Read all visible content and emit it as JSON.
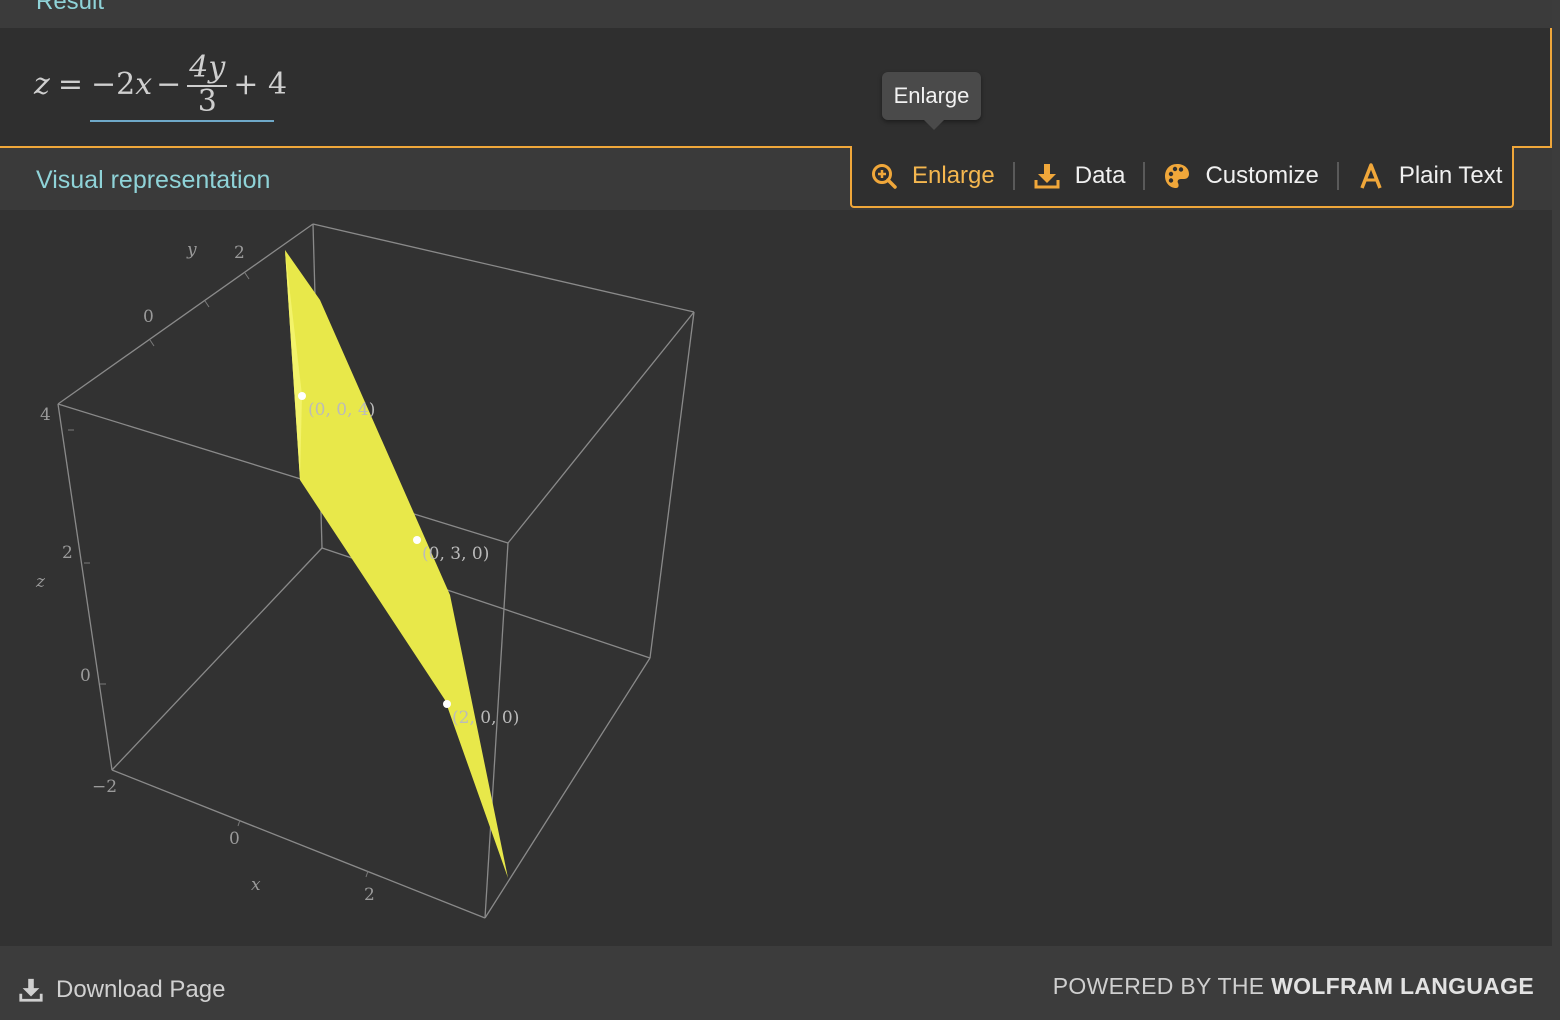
{
  "result": {
    "title": "Result",
    "formula": {
      "lhs": "z",
      "eq": "=",
      "part1": "−2",
      "var_x": "x",
      "minus": "−",
      "frac_num": "4y",
      "frac_den": "3",
      "tail": "+ 4"
    }
  },
  "tooltip": {
    "text": "Enlarge"
  },
  "visual": {
    "title": "Visual representation",
    "toolbar": {
      "enlarge_label": "Enlarge",
      "data_label": "Data",
      "customize_label": "Customize",
      "plain_text_label": "Plain Text"
    },
    "plot": {
      "axis_x_label": "x",
      "axis_y_label": "y",
      "axis_z_label": "z",
      "x_tick_0": "0",
      "x_tick_2": "2",
      "y_tick_0": "0",
      "y_tick_2": "2",
      "z_tick_n2": "−2",
      "z_tick_0": "0",
      "z_tick_2": "2",
      "z_tick_4": "4",
      "point_labels": [
        "(0, 0, 4)",
        "(0, 3, 0)",
        "(2, 0, 0)"
      ]
    }
  },
  "footer": {
    "download_label": "Download Page",
    "powered_prefix": "POWERED BY THE",
    "powered_brand": "WOLFRAM LANGUAGE"
  },
  "colors": {
    "accent": "#f0a73a",
    "heading": "#8fd3d8",
    "plane": "#e8e84a"
  }
}
